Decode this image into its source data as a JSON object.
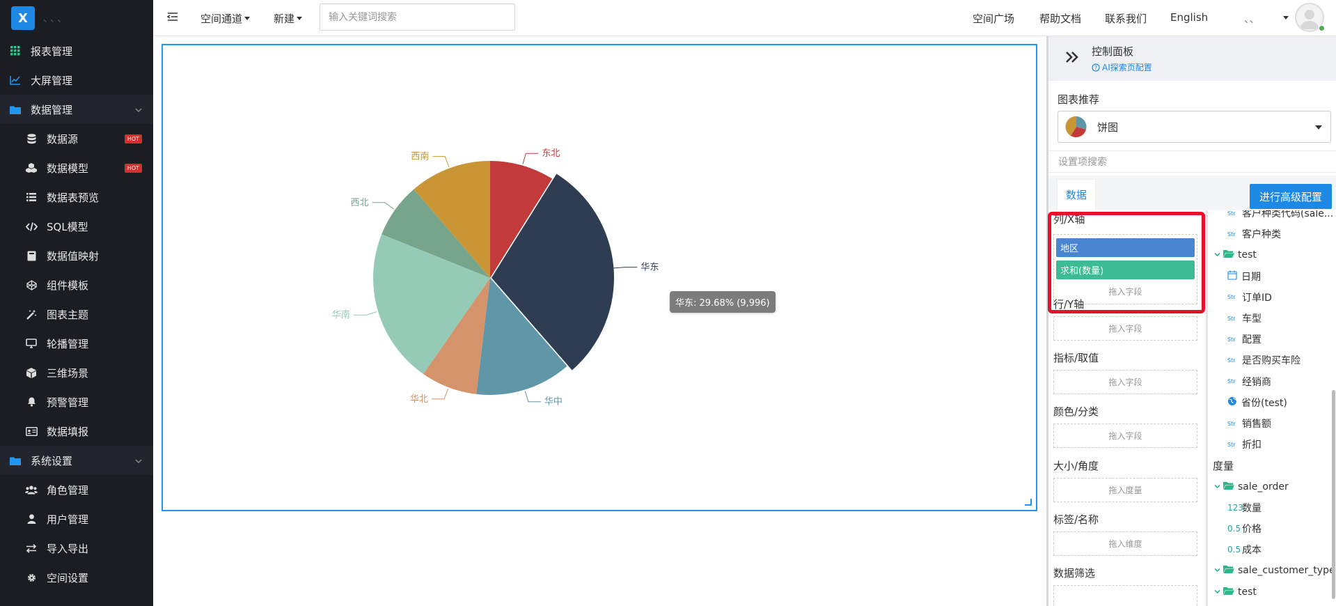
{
  "app": {
    "logo_letter": "X",
    "logo_text": "、、、"
  },
  "sidebar": {
    "items": [
      {
        "label": "报表管理",
        "icon": "grid-icon",
        "type": "top"
      },
      {
        "label": "大屏管理",
        "icon": "chart-line-icon",
        "type": "top"
      },
      {
        "label": "数据管理",
        "icon": "folder-icon",
        "type": "group"
      },
      {
        "label": "数据源",
        "icon": "database-icon",
        "type": "sub",
        "badge": "HOT"
      },
      {
        "label": "数据模型",
        "icon": "cubes-icon",
        "type": "sub",
        "badge": "HOT"
      },
      {
        "label": "数据表预览",
        "icon": "list-icon",
        "type": "sub"
      },
      {
        "label": "SQL模型",
        "icon": "code-icon",
        "type": "sub"
      },
      {
        "label": "数据值映射",
        "icon": "book-icon",
        "type": "sub"
      },
      {
        "label": "组件模板",
        "icon": "codepen-icon",
        "type": "sub"
      },
      {
        "label": "图表主题",
        "icon": "magic-icon",
        "type": "sub"
      },
      {
        "label": "轮播管理",
        "icon": "desktop-icon",
        "type": "sub"
      },
      {
        "label": "三维场景",
        "icon": "cube-icon",
        "type": "sub"
      },
      {
        "label": "预警管理",
        "icon": "bell-icon",
        "type": "sub"
      },
      {
        "label": "数据填报",
        "icon": "id-card-icon",
        "type": "sub"
      },
      {
        "label": "系统设置",
        "icon": "folder-icon",
        "type": "group"
      },
      {
        "label": "角色管理",
        "icon": "users-icon",
        "type": "sub"
      },
      {
        "label": "用户管理",
        "icon": "user-icon",
        "type": "sub"
      },
      {
        "label": "导入导出",
        "icon": "exchange-icon",
        "type": "sub"
      },
      {
        "label": "空间设置",
        "icon": "gear-icon",
        "type": "sub"
      }
    ]
  },
  "header": {
    "space_channel": "空间通道",
    "new": "新建",
    "search_placeholder": "输入关键词搜索",
    "links": [
      "空间广场",
      "帮助文档",
      "联系我们",
      "English"
    ],
    "user_name": "、、"
  },
  "chart_data": {
    "type": "pie",
    "categories": [
      "东北",
      "华东",
      "华中",
      "华北",
      "华南",
      "西北",
      "西南"
    ],
    "percent": [
      8.9,
      29.68,
      13.3,
      7.8,
      21.4,
      7.6,
      11.32
    ],
    "colors": [
      "#c23a3a",
      "#2f3d52",
      "#5f97a8",
      "#d4936b",
      "#95cbb6",
      "#76a58c",
      "#c99535"
    ],
    "highlighted": "华东",
    "tooltip": "华东: 29.68% (9,996)"
  },
  "panel": {
    "title": "控制面板",
    "ai_link": "AI探索页配置",
    "recommend_label": "图表推荐",
    "chart_type": "饼图",
    "setting_search_placeholder": "设置项搜索",
    "tab_data": "数据",
    "advanced_button": "进行高级配置",
    "dims": [
      {
        "label": "列/X轴",
        "placeholder": "拖入字段"
      },
      {
        "label": "行/Y轴",
        "placeholder": "拖入字段"
      },
      {
        "label": "指标/取值",
        "placeholder": "拖入字段"
      },
      {
        "label": "颜色/分类",
        "placeholder": "拖入字段"
      },
      {
        "label": "大小/角度",
        "placeholder": "拖入度量"
      },
      {
        "label": "标签/名称",
        "placeholder": "拖入维度"
      },
      {
        "label": "数据筛选",
        "placeholder": ""
      }
    ],
    "x_pills": [
      {
        "label": "地区",
        "color": "#4a86cf"
      },
      {
        "label": "求和(数量)",
        "color": "#3dbb92"
      }
    ],
    "fields": [
      {
        "label": "客户种类代码(sale...",
        "kind": "str",
        "indent": 2
      },
      {
        "label": "客户种类",
        "kind": "str",
        "indent": 2
      },
      {
        "label": "test",
        "kind": "folder",
        "indent": 1
      },
      {
        "label": "日期",
        "kind": "date",
        "indent": 2
      },
      {
        "label": "订单ID",
        "kind": "str",
        "indent": 2
      },
      {
        "label": "车型",
        "kind": "str",
        "indent": 2
      },
      {
        "label": "配置",
        "kind": "str",
        "indent": 2
      },
      {
        "label": "是否购买车险",
        "kind": "str",
        "indent": 2
      },
      {
        "label": "经销商",
        "kind": "str",
        "indent": 2
      },
      {
        "label": "省份(test)",
        "kind": "globe",
        "indent": 2
      },
      {
        "label": "销售额",
        "kind": "str",
        "indent": 2
      },
      {
        "label": "折扣",
        "kind": "str",
        "indent": 2
      },
      {
        "label": "度量",
        "kind": "section",
        "indent": 0
      },
      {
        "label": "sale_order",
        "kind": "folder",
        "indent": 1
      },
      {
        "label": "数量",
        "kind": "int",
        "indent": 2
      },
      {
        "label": "价格",
        "kind": "dec",
        "indent": 2
      },
      {
        "label": "成本",
        "kind": "dec",
        "indent": 2
      },
      {
        "label": "sale_customer_type",
        "kind": "folder",
        "indent": 1
      },
      {
        "label": "test",
        "kind": "folder",
        "indent": 1
      }
    ],
    "type_labels": {
      "str": "Str",
      "int": "123",
      "dec": "0.5"
    }
  }
}
